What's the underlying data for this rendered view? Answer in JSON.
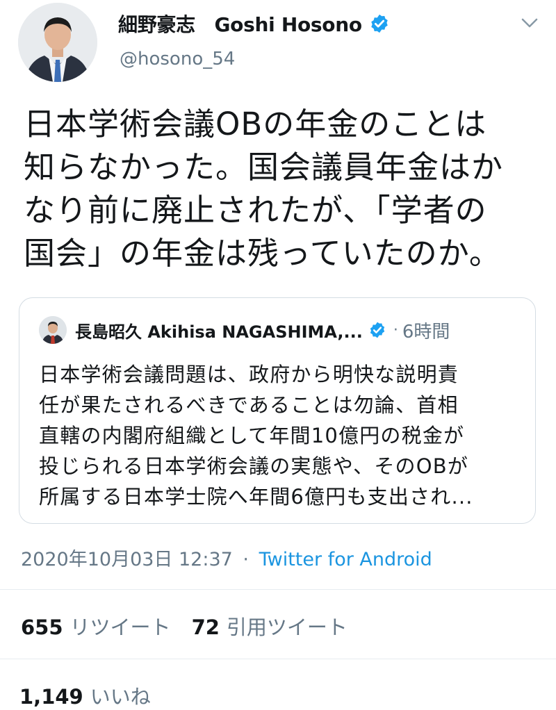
{
  "tweet": {
    "author": {
      "display_name": "細野豪志　Goshi Hosono",
      "handle": "@hosono_54",
      "verified": true
    },
    "text": "日本学術会議OBの年金のことは\n知らなかった。国会議員年金はか\nなり前に廃止されたが、「学者の\n国会」の年金は残っていたのか。",
    "quoted": {
      "display_name": "長島昭久 Akihisa NAGASHIMA,...",
      "verified": true,
      "dot": "·",
      "time": "6時間",
      "text": "日本学術会議問題は、政府から明快な説明責\n任が果たされるべきであることは勿論、首相\n直轄の内閣府組織として年間10億円の税金が\n投じられる日本学術会議の実態や、そのOBが\n所属する日本学士院へ年間6億円も支出され..."
    },
    "timestamp": "2020年10月03日 12:37",
    "separator": "·",
    "source": "Twitter for Android",
    "stats": {
      "retweets_count": "655",
      "retweets_label": "リツイート",
      "quotes_count": "72",
      "quotes_label": "引用ツイート",
      "likes_count": "1,149",
      "likes_label": "いいね"
    }
  },
  "colors": {
    "text": "#14171a",
    "muted": "#657786",
    "link": "#1b95e0",
    "verified": "#1da1f2",
    "border": "#d4dce3"
  },
  "icons": {
    "verified": "verified-badge-icon",
    "menu": "chevron-down-icon"
  }
}
